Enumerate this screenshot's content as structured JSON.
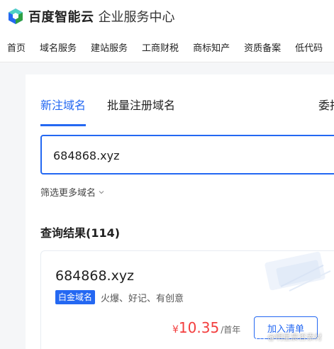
{
  "header": {
    "brand": "百度智能云",
    "brand_sub": "企业服务中心",
    "nav": [
      "首页",
      "域名服务",
      "建站服务",
      "工商财税",
      "商标知产",
      "资质备案",
      "低代码"
    ]
  },
  "tabs": {
    "new_domain": "新注域名",
    "bulk_register": "批量注册域名",
    "entrust": "委托"
  },
  "search": {
    "value": "684868.xyz"
  },
  "filter": {
    "label": "筛选更多域名"
  },
  "results": {
    "title": "查询结果(114)"
  },
  "result": {
    "domain": "684868.xyz",
    "tag": "白金域名",
    "desc": "火爆、好记、有创意",
    "price_currency": "¥",
    "price_value": "10.35",
    "price_unit": "/首年",
    "add_button": "加入清单"
  },
  "watermark": {
    "text": "@明星晨否素材"
  },
  "colors": {
    "accent": "#2468f2",
    "price": "#f33e3e"
  }
}
